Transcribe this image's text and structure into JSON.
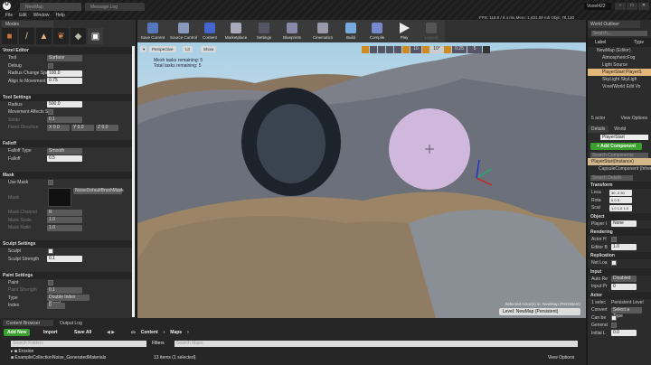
{
  "window": {
    "tabs": [
      "NewMap",
      "Message Log"
    ],
    "project": "Voxel422"
  },
  "menu": [
    "File",
    "Edit",
    "Window",
    "Help"
  ],
  "modes": {
    "tab": "Modes",
    "icons": [
      "place-icon",
      "paint-icon",
      "landscape-icon",
      "foliage-icon",
      "geometry-icon",
      "voxel-icon"
    ]
  },
  "voxel_editor": {
    "title": "Voxel Editor",
    "tool": {
      "label": "Tool",
      "value": "Surface"
    },
    "debug": {
      "label": "Debug"
    },
    "radius_change_speed": {
      "label": "Radius Change Speed",
      "value": "100.0"
    },
    "align": {
      "label": "Align to Movement Sn",
      "value": "0.75"
    }
  },
  "tool_settings": {
    "title": "Tool Settings",
    "radius": {
      "label": "Radius",
      "value": "500.0"
    },
    "movement": {
      "label": "Movement Affects Str"
    },
    "stride": {
      "label": "Stride",
      "value": "0.1"
    },
    "fixed_direction": {
      "label": "Fixed Direction",
      "x": "X 0.0",
      "y": "Y 0.0",
      "z": "Z 0.0"
    }
  },
  "falloff": {
    "title": "Falloff",
    "type": {
      "label": "Falloff Type",
      "value": "Smooth"
    },
    "falloff": {
      "label": "Falloff",
      "value": "0.5"
    }
  },
  "mask": {
    "title": "Mask",
    "use_mask": "Use Mask",
    "mask": {
      "label": "Mask",
      "value": "NoiseDefaultBrushMask"
    },
    "channel": {
      "label": "Mask Channel",
      "value": "R"
    },
    "scale": {
      "label": "Mask Scale",
      "value": "1.0"
    },
    "ratio": {
      "label": "Mask Ratio",
      "value": "1.0"
    }
  },
  "sculpt": {
    "title": "Sculpt Settings",
    "sculpt": "Sculpt",
    "strength": {
      "label": "Sculpt Strength",
      "value": "0.1"
    }
  },
  "paint": {
    "title": "Paint Settings",
    "paint": "Paint",
    "strength": {
      "label": "Paint Strength",
      "value": "0.1"
    },
    "type": {
      "label": "Type",
      "value": "Double Index Blend"
    },
    "index": {
      "label": "Index",
      "value": "0"
    }
  },
  "toolbar": [
    "Save Current",
    "Source Control",
    "Content",
    "Marketplace",
    "Settings",
    "Blueprints",
    "Cinematics",
    "Build",
    "Compile",
    "Play",
    "Launch"
  ],
  "stats": "FPS: 118.8 / 8.4 ms  Mem: 1,631.09 mb  Objs: 78,130",
  "viewport": {
    "menu": "▾",
    "perspective": "Perspective",
    "lit": "Lit",
    "show": "Show",
    "info1": "Mesh tasks remaining: 5",
    "info2": "Total tasks remaining: 5",
    "snap_angle": "10°",
    "snap_grid": "10",
    "snap_scale": "0.25",
    "cam_speed": "5",
    "selected": "Selected Actor(s) in: NewMap (Persistent)",
    "level": "Level:  NewMap (Persistent)"
  },
  "outliner": {
    "title": "World Outliner",
    "search": "Search...",
    "col_label": "Label",
    "col_type": "Type",
    "items": [
      "NewMap (Editor)",
      "AtmosphericFog",
      "Light Source",
      "PlayerStart PlayerS",
      "SkyLight SkyLigh",
      "VoxelWorld Edit Vo"
    ],
    "count": "5 actor",
    "view_options": "View Options"
  },
  "details": {
    "tab_details": "Details",
    "tab_world": "World",
    "name": "PlayerStart",
    "add_component": "+ Add Component",
    "search_components": "Search Components",
    "component_root": "PlayerStart(Instance)",
    "component_child": "CapsuleComponent (Inheri",
    "search_details": "Search Details",
    "transform": "Transform",
    "loc": "Loca",
    "rot": "Rota",
    "scale": "Scal",
    "loc_vals": [
      "30",
      "-3",
      "30"
    ],
    "rot_vals": [
      "0",
      "0",
      "0"
    ],
    "scale_vals": [
      "1.0",
      "1.0",
      "1.0"
    ],
    "object": "Object",
    "player": "Player I",
    "player_val": "None",
    "rendering": "Rendering",
    "actor_h": "Actor H",
    "editor_b": "Editor B",
    "editor_b_val": "1.0",
    "replication": "Replication",
    "net_load": "Net Loa",
    "input": "Input",
    "auto_re": "Auto Re",
    "auto_re_val": "Disabled",
    "input_pr": "Input Pr",
    "input_pr_val": "0",
    "actor": "Actor",
    "selected": "1 selec",
    "persistent": "Persistent Level",
    "convert": "Convert",
    "convert_val": "Select a Type",
    "can_be": "Can be",
    "generat": "Generat",
    "initial": "Initial L",
    "initial_val": "0.0"
  },
  "content_browser": {
    "tab": "Content Browser",
    "tab_output": "Output Log",
    "add_new": "Add New",
    "import": "Import",
    "save_all": "Save All",
    "path": [
      "Content",
      "Maps"
    ],
    "search_folders": "Search Folders",
    "folders": [
      "Erosion",
      "ExampleCollectionNoise_GeneratedMaterials"
    ],
    "filters": "Filters",
    "search_maps": "Search Maps",
    "items_count": "13 items (1 selected)",
    "view_options": "View Options"
  }
}
